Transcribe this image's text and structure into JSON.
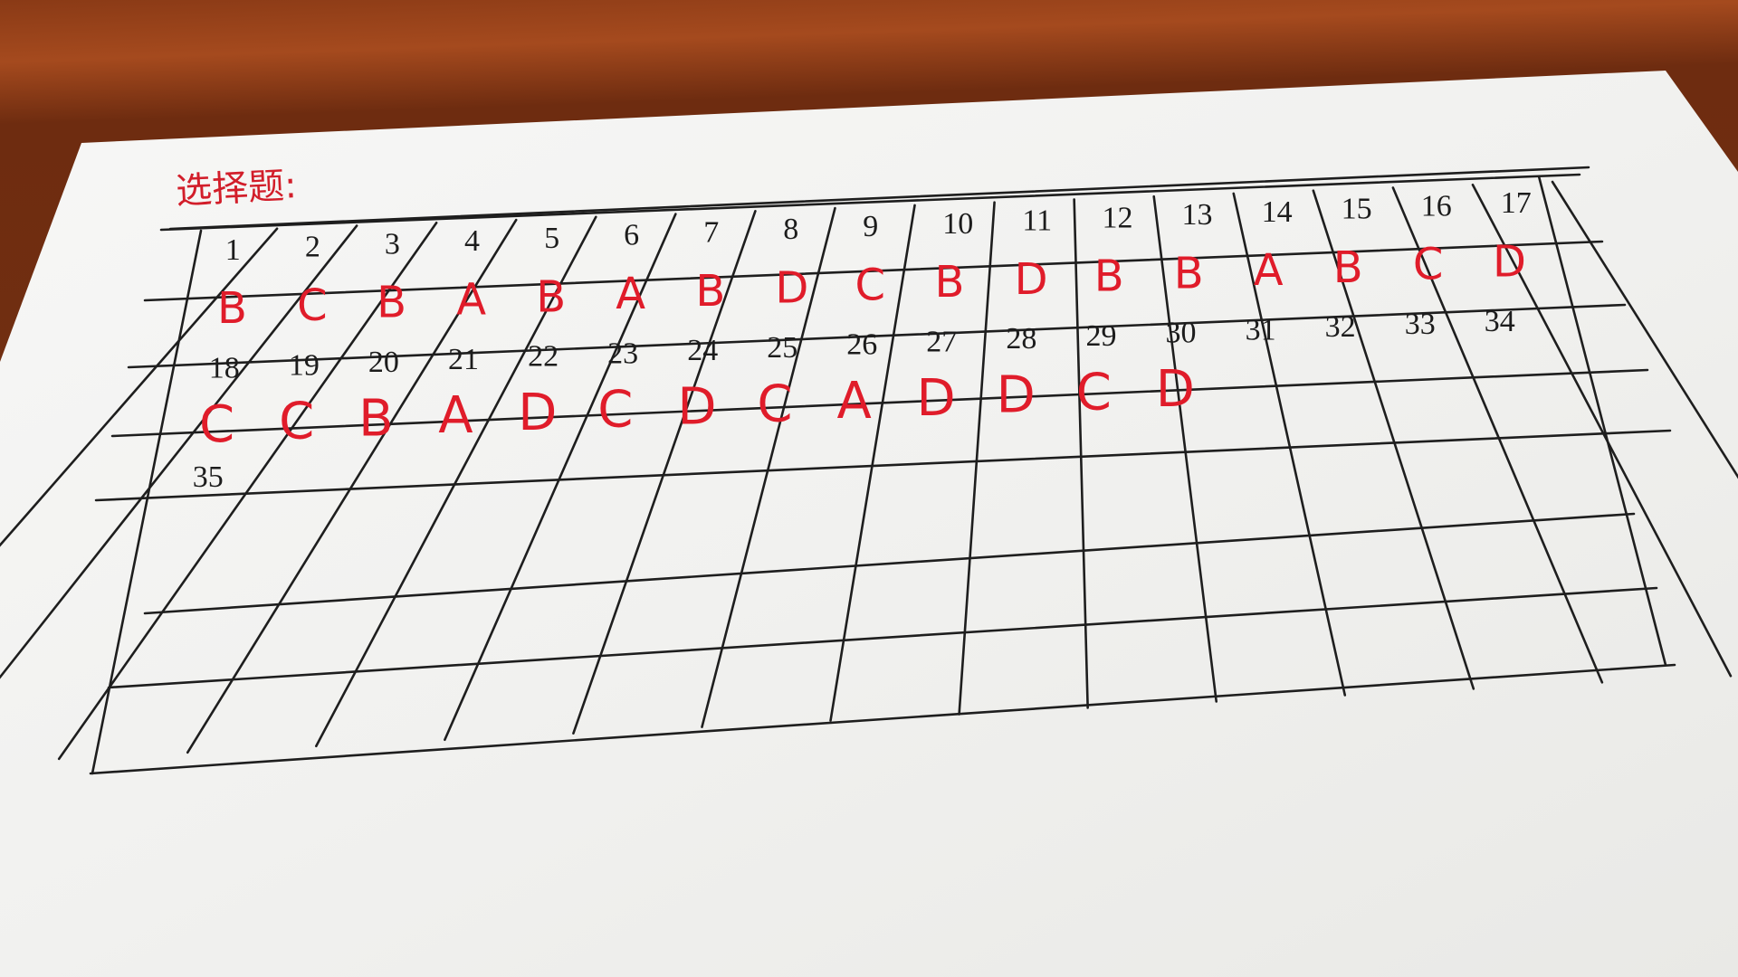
{
  "title": "选择题:",
  "rows": [
    {
      "numbers": [
        "1",
        "2",
        "3",
        "4",
        "5",
        "6",
        "7",
        "8",
        "9",
        "10",
        "11",
        "12",
        "13",
        "14",
        "15",
        "16",
        "17"
      ],
      "answers": [
        "B",
        "C",
        "B",
        "A",
        "B",
        "A",
        "B",
        "D",
        "C",
        "B",
        "D",
        "B",
        "B",
        "A",
        "B",
        "C",
        "D"
      ]
    },
    {
      "numbers": [
        "18",
        "19",
        "20",
        "21",
        "22",
        "23",
        "24",
        "25",
        "26",
        "27",
        "28",
        "29",
        "30",
        "31",
        "32",
        "33",
        "34"
      ],
      "answers": [
        "C",
        "C",
        "B",
        "A",
        "D",
        "C",
        "D",
        "C",
        "A",
        "D",
        "D",
        "C",
        "D",
        "",
        "",
        "",
        ""
      ]
    },
    {
      "numbers": [
        "35"
      ],
      "answers": []
    }
  ],
  "colors": {
    "ink_red": "#e01c2a",
    "ink_black": "#1c1c1c",
    "paper": "#f4f4f2",
    "desk": "#8a3a16"
  }
}
